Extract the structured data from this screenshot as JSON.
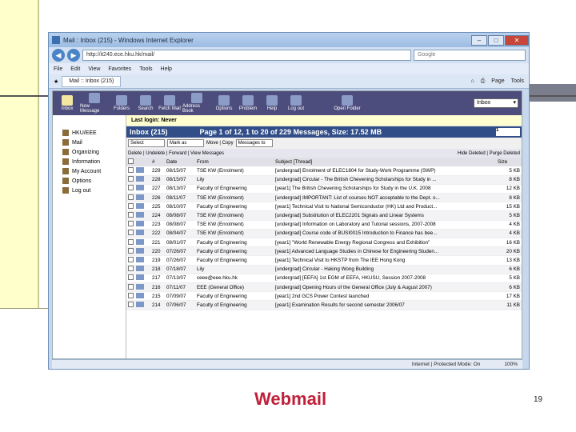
{
  "browser": {
    "title": "Mail : Inbox (215) - Windows Internet Explorer",
    "url": "http://it240.ece.hku.hk/mail/",
    "search_placeholder": "Google",
    "menu": [
      "File",
      "Edit",
      "View",
      "Favorites",
      "Tools",
      "Help"
    ],
    "tab": "Mail :: Inbox (215)",
    "commands": [
      "Page",
      "Tools"
    ],
    "status": "Internet | Protected Mode: On",
    "zoom": "100%"
  },
  "app": {
    "toolbar": [
      "Inbox",
      "New Message",
      "Folders",
      "Search",
      "Fetch Mail",
      "Address Book",
      "Options",
      "Problem",
      "Help",
      "Log out"
    ],
    "open_folder": "Open Folder",
    "folder_select": "Inbox",
    "sidebar": [
      "HKU/EEE",
      "Mail",
      "Organizing",
      "Information",
      "My Account",
      "Options",
      "Log out"
    ],
    "last_login": "Last login: Never",
    "inbox_title": "Inbox (215)",
    "page_info": "Page 1 of 12,  1 to 20 of 229 Messages,  Size: 17.52 MB",
    "page_select": "1",
    "select_label": "Select",
    "mark_label": "Mark as",
    "move_copy": "Move | Copy",
    "messages_to": "Messages to",
    "actions_left": "Delete | Undelete | Forward | View Messages",
    "actions_right": "Hide Deleted | Purge Deleted",
    "columns": [
      "#",
      "Date",
      "From",
      "Subject [Thread]",
      "Size"
    ],
    "rows": [
      {
        "num": "229",
        "date": "08/15/07",
        "from": "TSE KW (Enrolment)",
        "subject": "[undergrad] Enrolment of ELEC1804 for Study-Work Programme (SWP)",
        "size": "5 KB"
      },
      {
        "num": "228",
        "date": "08/15/07",
        "from": "Lily",
        "subject": "[undergrad] Circular - The British Chevening Scholarships for Study in ...",
        "size": "8 KB"
      },
      {
        "num": "227",
        "date": "08/13/07",
        "from": "Faculty of Engineering",
        "subject": "[year1] The British Chevening Scholarships for Study in the U.K. 2008",
        "size": "12 KB"
      },
      {
        "num": "226",
        "date": "08/11/07",
        "from": "TSE KW (Enrolment)",
        "subject": "[undergrad] IMPORTANT: List of courses NOT acceptable to the Dept. o...",
        "size": "8 KB"
      },
      {
        "num": "225",
        "date": "08/10/07",
        "from": "Faculty of Engineering",
        "subject": "[year1] Technical Visit to National Semiconductor (HK) Ltd and Product...",
        "size": "15 KB"
      },
      {
        "num": "224",
        "date": "08/08/07",
        "from": "TSE KW (Enrolment)",
        "subject": "[undergrad] Substitution of ELEC2201 Signals and Linear Systems",
        "size": "5 KB"
      },
      {
        "num": "223",
        "date": "08/08/07",
        "from": "TSE KW (Enrolment)",
        "subject": "[undergrad] Information on Laboratory and Tutorial sessions, 2007-2008",
        "size": "4 KB"
      },
      {
        "num": "222",
        "date": "08/04/07",
        "from": "TSE KW (Enrolment)",
        "subject": "[undergrad] Course code of BUSI0015 Introduction to Finance has bee...",
        "size": "4 KB"
      },
      {
        "num": "221",
        "date": "08/01/07",
        "from": "Faculty of Engineering",
        "subject": "[year1] \"World Renewable Energy Regional Congress and Exhibition\"",
        "size": "16 KB"
      },
      {
        "num": "220",
        "date": "07/26/07",
        "from": "Faculty of Engineering",
        "subject": "[year1] Advanced Language Studies in Chinese for Engineering Studen...",
        "size": "20 KB"
      },
      {
        "num": "219",
        "date": "07/26/07",
        "from": "Faculty of Engineering",
        "subject": "[year1] Technical Visit to HKSTP from The IEE Hong Kong",
        "size": "13 KB"
      },
      {
        "num": "218",
        "date": "07/18/07",
        "from": "Lily",
        "subject": "[undergrad] Circular - Haking Wong Building",
        "size": "6 KB"
      },
      {
        "num": "217",
        "date": "07/13/07",
        "from": "ceee@eee.hku.hk",
        "subject": "[undergrad] [EEFA] 1st EGM of EEFA, HKUSU, Session 2007-2008",
        "size": "5 KB"
      },
      {
        "num": "216",
        "date": "07/11/07",
        "from": "EEE (General Office)",
        "subject": "[undergrad] Opening Hours of the General Office (July & August 2007)",
        "size": "6 KB"
      },
      {
        "num": "215",
        "date": "07/09/07",
        "from": "Faculty of Engineering",
        "subject": "[year1] 2nd GCS Power Contest launched",
        "size": "17 KB"
      },
      {
        "num": "214",
        "date": "07/06/07",
        "from": "Faculty of Engineering",
        "subject": "[year1] Examination Results for second semester 2006/07",
        "size": "11 KB"
      }
    ]
  },
  "slide": {
    "caption": "Webmail",
    "page_number": "19"
  }
}
